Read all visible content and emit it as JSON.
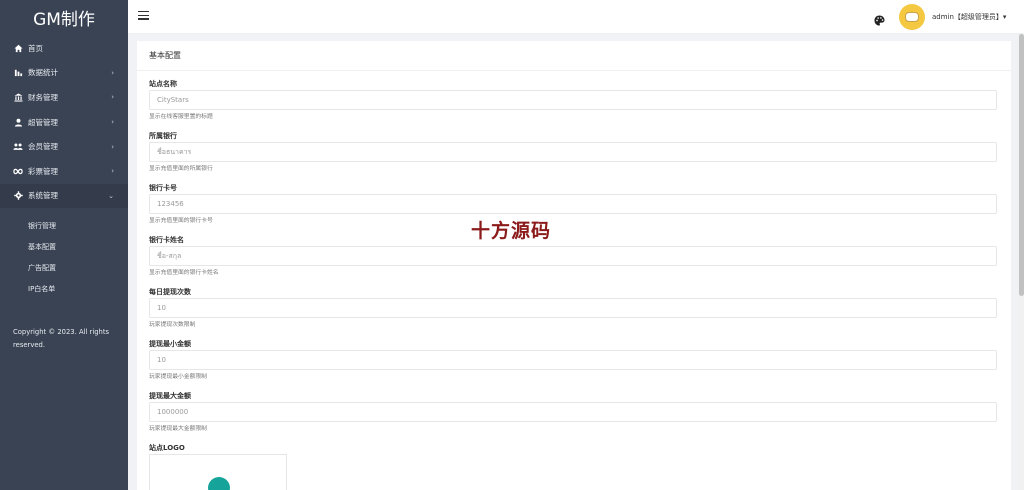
{
  "brand": "GM制作",
  "sidebar": {
    "items": [
      {
        "label": "首页",
        "icon": "home-icon",
        "chevron": ""
      },
      {
        "label": "数据统计",
        "icon": "bar-chart-icon",
        "chevron": "›"
      },
      {
        "label": "财务管理",
        "icon": "bank-icon",
        "chevron": "›"
      },
      {
        "label": "超管管理",
        "icon": "user-icon",
        "chevron": "›"
      },
      {
        "label": "会员管理",
        "icon": "users-icon",
        "chevron": "›"
      },
      {
        "label": "彩票管理",
        "icon": "infinity-icon",
        "chevron": "›"
      },
      {
        "label": "系统管理",
        "icon": "gear-icon",
        "chevron": "⌄"
      }
    ],
    "subitems": [
      "银行管理",
      "基本配置",
      "广告配置",
      "IP白名单"
    ],
    "copyright": "Copyright © 2023. All rights reserved."
  },
  "header": {
    "user": "admin【超级管理员】▾"
  },
  "card": {
    "title": "基本配置",
    "fields": [
      {
        "label": "站点名称",
        "value": "CityStars",
        "help": "显示在线客服里置的标题"
      },
      {
        "label": "所属银行",
        "value": "ชื่อธนาคาร",
        "help": "显示充值里面的所属银行"
      },
      {
        "label": "银行卡号",
        "value": "123456",
        "help": "显示充值里面的银行卡号"
      },
      {
        "label": "银行卡姓名",
        "value": "ชื่อ-สกุล",
        "help": "显示充值里面的银行卡姓名"
      },
      {
        "label": "每日提现次数",
        "value": "10",
        "help": "玩家提现次数限制"
      },
      {
        "label": "提现最小金额",
        "value": "10",
        "help": "玩家提现最小金额限制"
      },
      {
        "label": "提现最大金额",
        "value": "1000000",
        "help": "玩家提现最大金额限制"
      }
    ],
    "logo_label": "站点LOGO"
  },
  "watermark": "十方源码",
  "colors": {
    "sidebar_bg": "#3a4354",
    "watermark": "#8b1a1a",
    "logo": "#16a39a",
    "avatar": "#f5c842"
  }
}
